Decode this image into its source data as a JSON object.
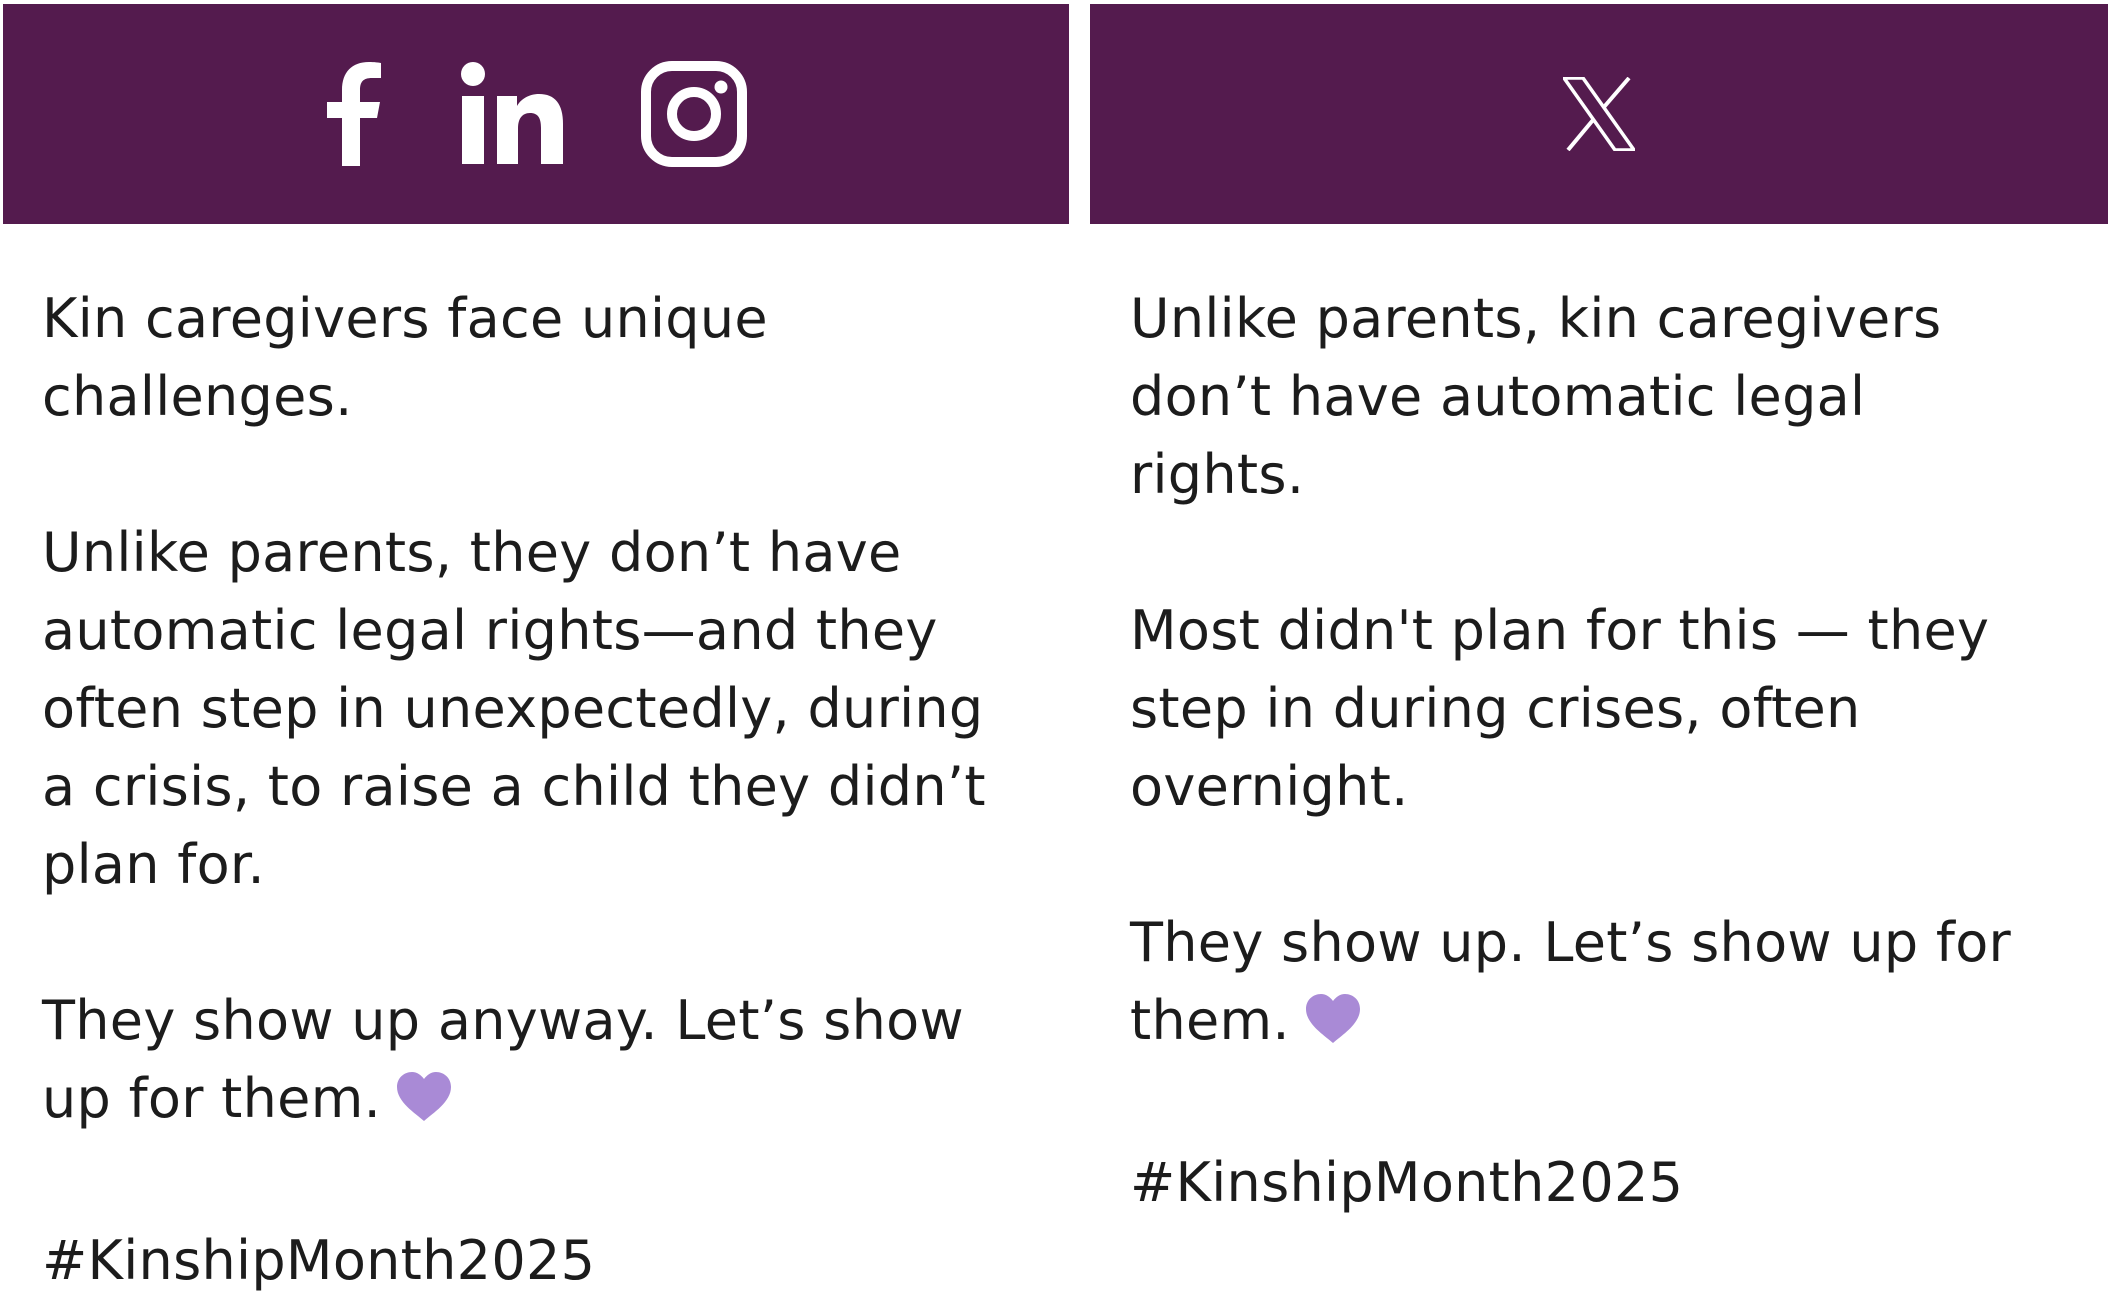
{
  "colors": {
    "header_bg": "#541b4e",
    "icon": "#ffffff",
    "heart": "#a98ad6",
    "text": "#1c1c1c"
  },
  "left_panel": {
    "icons": [
      "facebook-icon",
      "linkedin-icon",
      "instagram-icon"
    ],
    "paragraphs": [
      "Kin caregivers face unique\nchallenges.",
      "Unlike parents, they don’t have\nautomatic legal rights—and they\noften step in unexpectedly, during\na crisis, to raise a child they didn’t\nplan for.",
      "They show up anyway. Let’s show\nup for them.",
      "#KinshipMonth2025"
    ]
  },
  "right_panel": {
    "icons": [
      "x-icon"
    ],
    "paragraphs": [
      "Unlike parents, kin caregivers\ndon’t have automatic legal\nrights.",
      "Most didn't plan for this — they\nstep in during crises, often\novernight.",
      "They show up. Let’s show up for\nthem.",
      "#KinshipMonth2025"
    ]
  }
}
